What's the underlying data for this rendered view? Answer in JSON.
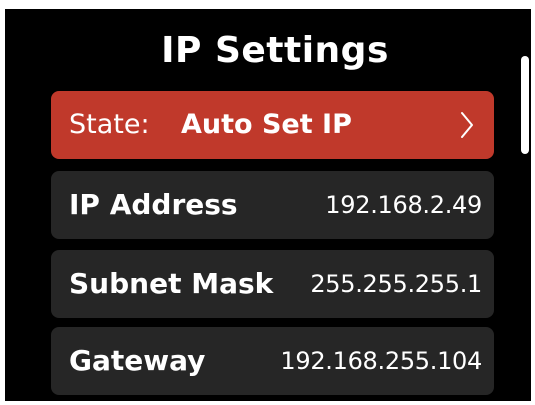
{
  "header": {
    "title": "IP Settings"
  },
  "rows": {
    "state": {
      "label": "State:",
      "value": "Auto Set IP",
      "icon": "chevron-right-icon"
    },
    "ip_address": {
      "label": "IP Address",
      "value": "192.168.2.49"
    },
    "subnet_mask": {
      "label": "Subnet Mask",
      "value": "255.255.255.1"
    },
    "gateway": {
      "label": "Gateway",
      "value": "192.168.255.104"
    }
  },
  "colors": {
    "background": "#000000",
    "selected_row": "#c0392b",
    "row": "#262626",
    "text": "#ffffff"
  }
}
